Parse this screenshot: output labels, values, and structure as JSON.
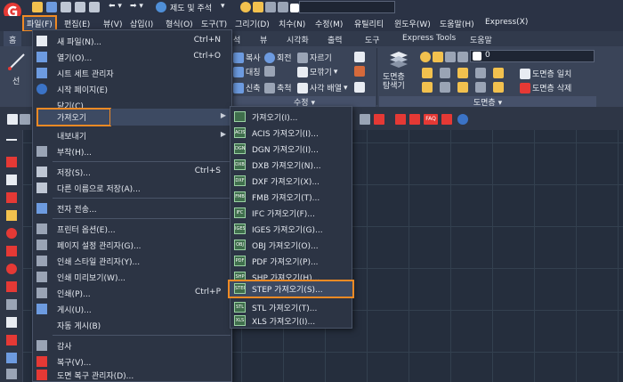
{
  "quick_access": {
    "workspace_label": "제도 및 주석",
    "layer_value": "0"
  },
  "menu_bar": {
    "items": [
      "파일(F)",
      "편집(E)",
      "뷰(V)",
      "삽입(I)",
      "형식(O)",
      "도구(T)",
      "그리기(D)",
      "치수(N)",
      "수정(M)",
      "유틸리티",
      "윈도우(W)",
      "도움말(H)",
      "Express(X)"
    ]
  },
  "ribbon_tabs": {
    "items": [
      "홈",
      "석",
      "뷰",
      "시각화",
      "출력",
      "도구",
      "Express Tools",
      "도움말"
    ]
  },
  "ribbon": {
    "line_label": "선",
    "copy": "복사",
    "rotate": "회전",
    "trim": "자르기",
    "mirror": "대칭",
    "fillet": "모깎기",
    "stretch": "신축",
    "scale": "축척",
    "array": "사각 배열",
    "modify_panel": "수정",
    "layer_props": "도면층\n탐색기",
    "layer_value": "0",
    "layer_match": "도면층 일치",
    "layer_delete": "도면층 삭제",
    "layer_panel": "도면층"
  },
  "file_menu": {
    "items": [
      {
        "label": "새 파일(N)...",
        "shortcut": "Ctrl+N"
      },
      {
        "label": "열기(O)...",
        "shortcut": "Ctrl+O"
      },
      {
        "label": "시트 세트 관리자",
        "shortcut": ""
      },
      {
        "label": "시작 페이지(E)",
        "shortcut": ""
      },
      {
        "label": "닫기(C)",
        "shortcut": ""
      },
      {
        "label": "가져오기",
        "shortcut": ""
      },
      {
        "label": "내보내기",
        "shortcut": ""
      },
      {
        "label": "부착(H)...",
        "shortcut": ""
      },
      {
        "label": "저장(S)...",
        "shortcut": "Ctrl+S"
      },
      {
        "label": "다른 이름으로 저장(A)...",
        "shortcut": ""
      },
      {
        "label": "전자 전송...",
        "shortcut": ""
      },
      {
        "label": "프린터 옵션(E)...",
        "shortcut": ""
      },
      {
        "label": "페이지 설정 관리자(G)...",
        "shortcut": ""
      },
      {
        "label": "인쇄 스타일 관리자(Y)...",
        "shortcut": ""
      },
      {
        "label": "인쇄 미리보기(W)...",
        "shortcut": ""
      },
      {
        "label": "인쇄(P)...",
        "shortcut": "Ctrl+P"
      },
      {
        "label": "게시(U)...",
        "shortcut": ""
      },
      {
        "label": "자동 게시(B)",
        "shortcut": ""
      },
      {
        "label": "감사",
        "shortcut": ""
      },
      {
        "label": "복구(V)...",
        "shortcut": ""
      },
      {
        "label": "도면 복구 관리자(D)...",
        "shortcut": ""
      }
    ]
  },
  "import_submenu": {
    "items": [
      {
        "label": "가져오기(I)...",
        "icon": ""
      },
      {
        "label": "ACIS 가져오기(I)...",
        "icon": "ACIS"
      },
      {
        "label": "DGN 가져오기(I)...",
        "icon": "DGN"
      },
      {
        "label": "DXB 가져오기(N)...",
        "icon": "DXB"
      },
      {
        "label": "DXF 가져오기(X)...",
        "icon": "DXF"
      },
      {
        "label": "FMB 가져오기(T)...",
        "icon": "FMB"
      },
      {
        "label": "IFC 가져오기(F)...",
        "icon": "IFC"
      },
      {
        "label": "IGES 가져오기(G)...",
        "icon": "IGES"
      },
      {
        "label": "OBJ 가져오기(O)...",
        "icon": "OBJ"
      },
      {
        "label": "PDF 가져오기(P)...",
        "icon": "PDF"
      },
      {
        "label": "SHP 가져오기(H)...",
        "icon": "SHP"
      },
      {
        "label": "STEP 가져오기(S)...",
        "icon": "STEP"
      },
      {
        "label": "STL 가져오기(T)...",
        "icon": "STL"
      },
      {
        "label": "XLS 가져오기(I)...",
        "icon": "XLS"
      }
    ]
  },
  "toolbar_row": {
    "faq": "FAQ"
  },
  "colors": {
    "highlight": "#f08a24",
    "app_logo": "#e53935",
    "menu_bg": "#2c3444"
  }
}
